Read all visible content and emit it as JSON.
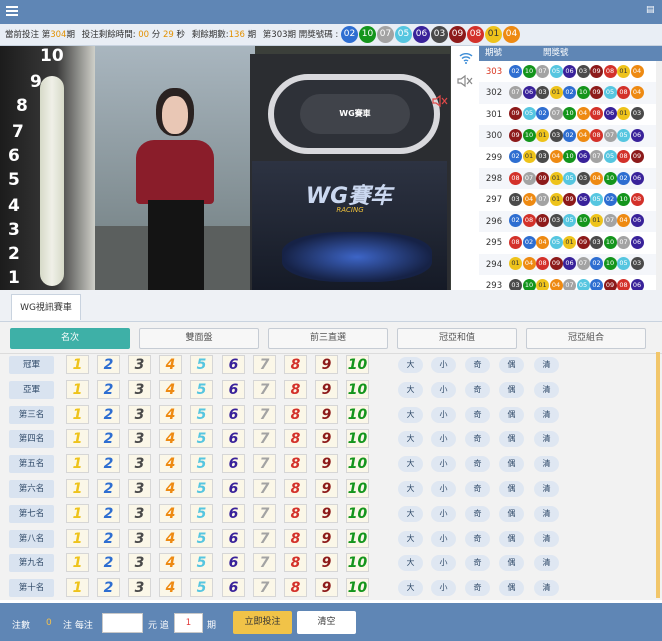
{
  "colors": {
    "c01": "#eec31b",
    "c02": "#2e6ed1",
    "c03": "#4a4a4a",
    "c04": "#ee8a12",
    "c05": "#56c6e0",
    "c06": "#39229a",
    "c07": "#a3a3a3",
    "c08": "#d3312a",
    "c09": "#8d1a1a",
    "c10": "#14951c"
  },
  "infobar": {
    "cur_label": "當前投注",
    "cur_issue_pre": "第",
    "cur_issue": "304",
    "cur_issue_post": "期",
    "countdown_label": "投注剩餘時間:",
    "min": "00",
    "min_unit": "分",
    "sec": "29",
    "sec_unit": "秒",
    "remain_label": "剩餘期數:",
    "remain": "136",
    "remain_unit": "期",
    "last_issue_text": "第303期 開獎號碼 :",
    "last_result": [
      "02",
      "10",
      "07",
      "05",
      "06",
      "03",
      "09",
      "08",
      "01",
      "04"
    ]
  },
  "video": {
    "tube_numbers": [
      "10",
      "9",
      "8",
      "7",
      "6",
      "5",
      "4",
      "3",
      "2",
      "1"
    ],
    "track_label": "WG賽車",
    "banner_logo": "WG賽车",
    "banner_sub": "RACING"
  },
  "history": {
    "col_issue": "期號",
    "col_result": "開獎號",
    "rows": [
      {
        "issue": "303",
        "nums": [
          "02",
          "10",
          "07",
          "05",
          "06",
          "03",
          "09",
          "08",
          "01",
          "04"
        ]
      },
      {
        "issue": "302",
        "nums": [
          "07",
          "06",
          "03",
          "01",
          "02",
          "10",
          "09",
          "05",
          "08",
          "04"
        ]
      },
      {
        "issue": "301",
        "nums": [
          "09",
          "05",
          "02",
          "07",
          "10",
          "04",
          "08",
          "06",
          "01",
          "03"
        ]
      },
      {
        "issue": "300",
        "nums": [
          "09",
          "10",
          "01",
          "03",
          "02",
          "04",
          "08",
          "07",
          "05",
          "06"
        ]
      },
      {
        "issue": "299",
        "nums": [
          "02",
          "01",
          "03",
          "04",
          "10",
          "06",
          "07",
          "05",
          "08",
          "09"
        ]
      },
      {
        "issue": "298",
        "nums": [
          "08",
          "07",
          "09",
          "01",
          "05",
          "03",
          "04",
          "10",
          "02",
          "06"
        ]
      },
      {
        "issue": "297",
        "nums": [
          "03",
          "04",
          "07",
          "01",
          "09",
          "06",
          "05",
          "02",
          "10",
          "08"
        ]
      },
      {
        "issue": "296",
        "nums": [
          "02",
          "08",
          "09",
          "03",
          "05",
          "10",
          "01",
          "07",
          "04",
          "06"
        ]
      },
      {
        "issue": "295",
        "nums": [
          "08",
          "02",
          "04",
          "05",
          "01",
          "09",
          "03",
          "10",
          "07",
          "06"
        ]
      },
      {
        "issue": "294",
        "nums": [
          "01",
          "04",
          "08",
          "09",
          "06",
          "07",
          "02",
          "10",
          "05",
          "03"
        ]
      },
      {
        "issue": "293",
        "nums": [
          "03",
          "10",
          "01",
          "04",
          "07",
          "05",
          "02",
          "09",
          "08",
          "06"
        ]
      }
    ]
  },
  "tab": {
    "label": "WG視訊賽車"
  },
  "play_tabs": [
    "名次",
    "雙面盤",
    "前三直選",
    "冠亞和值",
    "冠亞組合"
  ],
  "positions": [
    "冠軍",
    "亞軍",
    "第三名",
    "第四名",
    "第五名",
    "第六名",
    "第七名",
    "第八名",
    "第九名",
    "第十名"
  ],
  "numbers": [
    "1",
    "2",
    "3",
    "4",
    "5",
    "6",
    "7",
    "8",
    "9",
    "10"
  ],
  "quick_picks": [
    "大",
    "小",
    "奇",
    "偶",
    "清"
  ],
  "footer": {
    "count_label": "注數",
    "count": "0",
    "per_bet_label": "注 每注",
    "amount": "",
    "yuan_chase": "元 追",
    "chase": "1",
    "issue_unit": "期",
    "submit": "立即投注",
    "clear": "清空"
  }
}
